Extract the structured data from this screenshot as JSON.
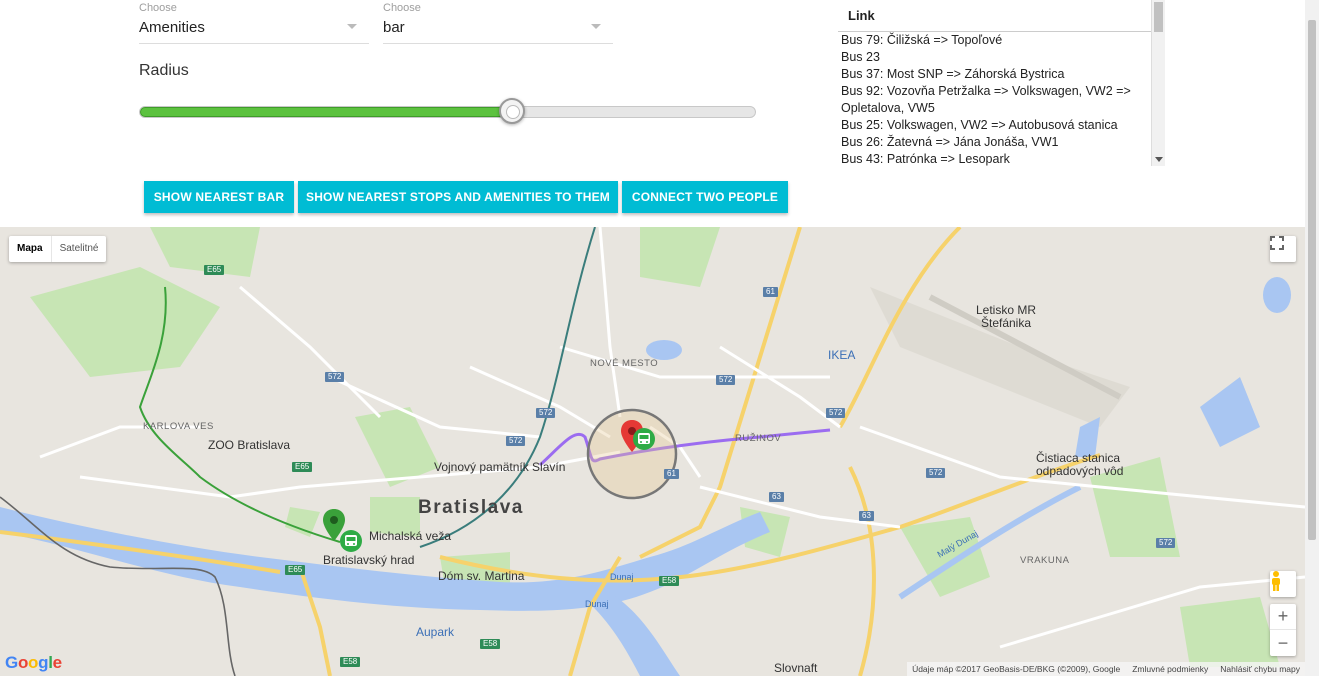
{
  "controls": {
    "select1": {
      "caption": "Choose",
      "value": "Amenities"
    },
    "select2": {
      "caption": "Choose",
      "value": "bar"
    },
    "radius_label": "Radius",
    "radius_fraction": 0.605,
    "buttons": {
      "nearest_bar": "SHOW NEAREST BAR",
      "nearest_stops": "SHOW NEAREST STOPS AND AMENITIES TO THEM",
      "connect": "CONNECT TWO PEOPLE"
    }
  },
  "links": {
    "header": "Link",
    "items": [
      "Bus 79: Čiližská => Topoľové",
      "Bus 23",
      "Bus 37: Most SNP => Záhorská Bystrica",
      "Bus 92: Vozovňa Petržalka => Volkswagen, VW2 => Opletalova, VW5",
      "Bus 25: Volkswagen, VW2 => Autobusová stanica",
      "Bus 26: Žatevná => Jána Jonáša, VW1",
      "Bus 43: Patrónka => Lesopark"
    ]
  },
  "map": {
    "type_map": "Mapa",
    "type_satellite": "Satelitné",
    "zoom_in": "+",
    "zoom_out": "−",
    "google": "Google",
    "attribution": "Údaje máp ©2017 GeoBasis-DE/BKG (©2009), Google",
    "terms": "Zmluvné podmienky",
    "report": "Nahlásiť chybu mapy",
    "labels": {
      "bratislava": "Bratislava",
      "nove_mesto": "NOVÉ MESTO",
      "ruzinov": "RUŽINOV",
      "karlova_ves": "KARLOVA VES",
      "vrakuna": "VRAKUNA",
      "zoo": "ZOO Bratislava",
      "vojnovy": "Vojnový pamätník Slavín",
      "michalska": "Michalská veža",
      "hrad": "Bratislavský hrad",
      "dom": "Dóm sv. Martina",
      "aupark": "Aupark",
      "ikea": "IKEA",
      "letisko": "Letisko MR\nŠtefánika",
      "cistiaca": "Čistiaca stanica\nodpadových vôd",
      "slovnaft": "Slovnaft",
      "dunaj": "Dunaj",
      "maly_dunaj": "Malý Dunaj"
    },
    "road_numbers": [
      "E65",
      "572",
      "61",
      "63",
      "E58"
    ]
  },
  "colors": {
    "accent": "#00bcd4",
    "slider_green": "#5cc23f",
    "route_purple": "#9b6cf0",
    "marker_red": "#e53935",
    "marker_green": "#3aa13a",
    "river": "#a9c6f2",
    "park": "#c7e5b4"
  }
}
